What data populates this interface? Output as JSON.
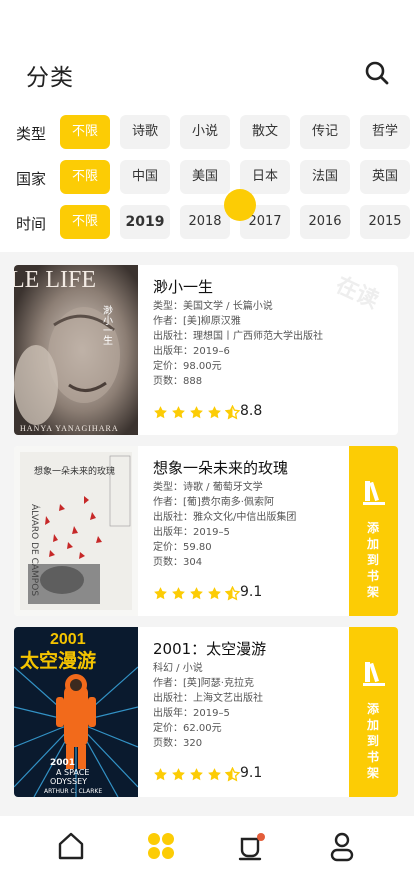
{
  "header": {
    "title": "分类"
  },
  "filters": [
    {
      "label": "类型",
      "options": [
        "不限",
        "诗歌",
        "小说",
        "散文",
        "传记",
        "哲学"
      ]
    },
    {
      "label": "国家",
      "options": [
        "不限",
        "中国",
        "美国",
        "日本",
        "法国",
        "英国"
      ]
    },
    {
      "label": "时间",
      "options": [
        "不限",
        "2019",
        "2018",
        "2017",
        "2016",
        "2015"
      ]
    }
  ],
  "books": [
    {
      "title": "渺小一生",
      "type": "类型：美国文学 / 长篇小说",
      "author": "作者：[美]柳原汉雅",
      "publisher": "出版社：理想国丨广西师范大学出版社",
      "year": "出版年：2019–6",
      "price": "定价：98.00元",
      "pages": "页数：888",
      "rating": "8.8",
      "watermark": "在读",
      "cover_text": "LE LIFE",
      "cover_spine": "渺小一生",
      "cover_author": "HANYA YANAGIHARA"
    },
    {
      "title": "想象一朵未来的玫瑰",
      "type": "类型：诗歌 / 葡萄牙文学",
      "author": "作者：[葡]费尔南多·佩索阿",
      "publisher": "出版社：雅众文化/中信出版集团",
      "year": "出版年：2019–5",
      "price": "定价：59.80",
      "pages": "页数：304",
      "rating": "9.1",
      "add_label": "添加到书架",
      "cover_text": "想象一朵未来的玫瑰",
      "cover_spine": "ÁLVARO DE CAMPOS"
    },
    {
      "title": "2001：太空漫游",
      "type": "科幻 / 小说",
      "author": "作者：[英]阿瑟·克拉克",
      "publisher": "出版社：上海文艺出版社",
      "year": "出版年：2019–5",
      "price": "定价：62.00元",
      "pages": "页数：320",
      "rating": "9.1",
      "add_label": "添加到书架",
      "cover_year": "2001",
      "cover_title": "太空漫游",
      "cover_en_1": "2001",
      "cover_en_2": "A SPACE",
      "cover_en_3": "ODYSSEY",
      "cover_en_4": "ARTHUR C. CLARKE"
    }
  ],
  "nav": [
    "home-icon",
    "category-icon",
    "reading-icon",
    "profile-icon"
  ],
  "colors": {
    "accent": "#fccc05"
  }
}
